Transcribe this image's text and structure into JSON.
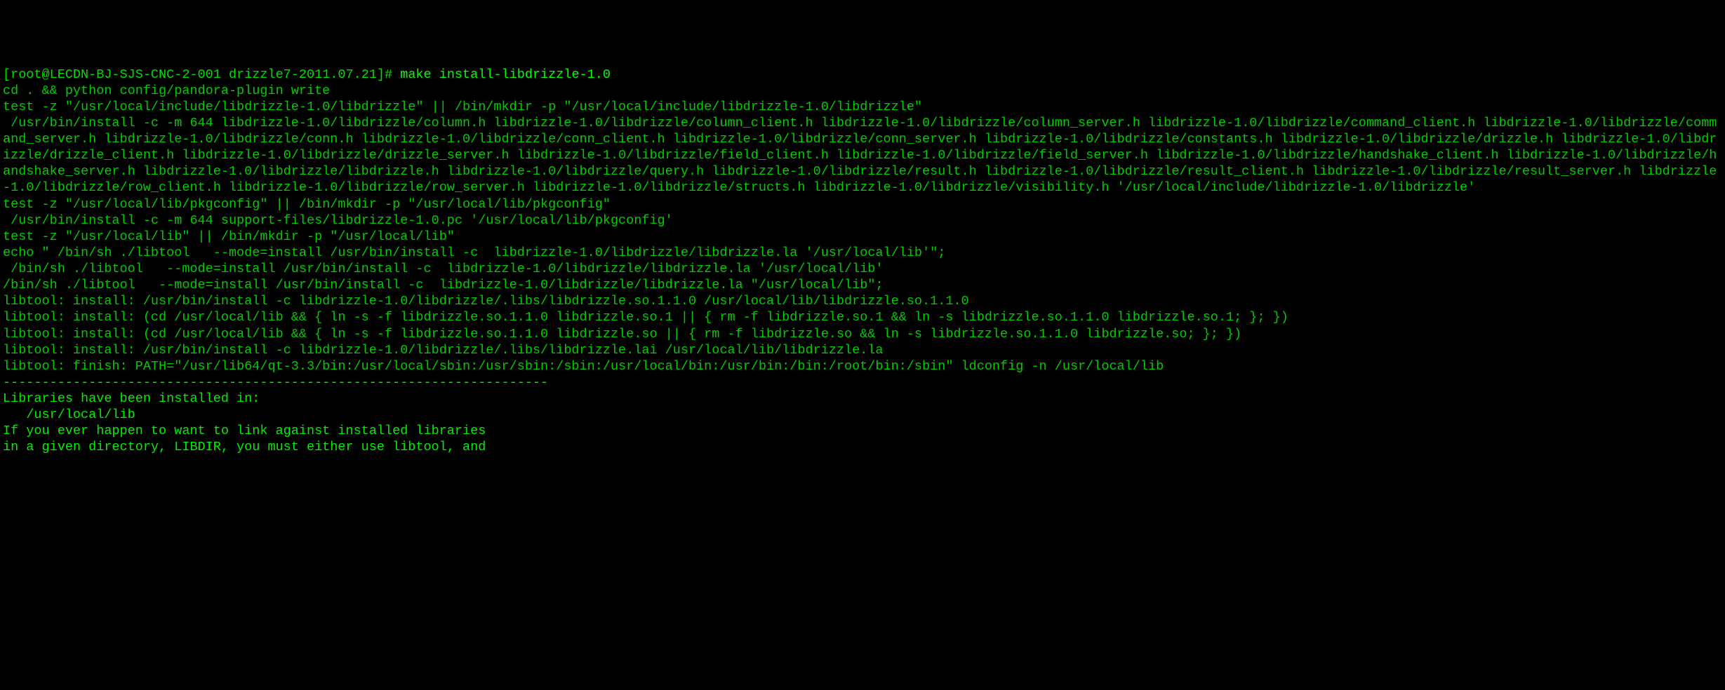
{
  "terminal": {
    "prompt": {
      "user_host": "[root@LECDN-BJ-SJS-CNC-2-001",
      "cwd": "drizzle7-2011.07.21]#",
      "command": "make install-libdrizzle-1.0"
    },
    "lines": [
      "cd . && python config/pandora-plugin write",
      "test -z \"/usr/local/include/libdrizzle-1.0/libdrizzle\" || /bin/mkdir -p \"/usr/local/include/libdrizzle-1.0/libdrizzle\"",
      " /usr/bin/install -c -m 644 libdrizzle-1.0/libdrizzle/column.h libdrizzle-1.0/libdrizzle/column_client.h libdrizzle-1.0/libdrizzle/column_server.h libdrizzle-1.0/libdrizzle/command_client.h libdrizzle-1.0/libdrizzle/command_server.h libdrizzle-1.0/libdrizzle/conn.h libdrizzle-1.0/libdrizzle/conn_client.h libdrizzle-1.0/libdrizzle/conn_server.h libdrizzle-1.0/libdrizzle/constants.h libdrizzle-1.0/libdrizzle/drizzle.h libdrizzle-1.0/libdrizzle/drizzle_client.h libdrizzle-1.0/libdrizzle/drizzle_server.h libdrizzle-1.0/libdrizzle/field_client.h libdrizzle-1.0/libdrizzle/field_server.h libdrizzle-1.0/libdrizzle/handshake_client.h libdrizzle-1.0/libdrizzle/handshake_server.h libdrizzle-1.0/libdrizzle/libdrizzle.h libdrizzle-1.0/libdrizzle/query.h libdrizzle-1.0/libdrizzle/result.h libdrizzle-1.0/libdrizzle/result_client.h libdrizzle-1.0/libdrizzle/result_server.h libdrizzle-1.0/libdrizzle/row_client.h libdrizzle-1.0/libdrizzle/row_server.h libdrizzle-1.0/libdrizzle/structs.h libdrizzle-1.0/libdrizzle/visibility.h '/usr/local/include/libdrizzle-1.0/libdrizzle'",
      "test -z \"/usr/local/lib/pkgconfig\" || /bin/mkdir -p \"/usr/local/lib/pkgconfig\"",
      " /usr/bin/install -c -m 644 support-files/libdrizzle-1.0.pc '/usr/local/lib/pkgconfig'",
      "test -z \"/usr/local/lib\" || /bin/mkdir -p \"/usr/local/lib\"",
      "echo \" /bin/sh ./libtool   --mode=install /usr/bin/install -c  libdrizzle-1.0/libdrizzle/libdrizzle.la '/usr/local/lib'\";",
      " /bin/sh ./libtool   --mode=install /usr/bin/install -c  libdrizzle-1.0/libdrizzle/libdrizzle.la '/usr/local/lib'",
      "/bin/sh ./libtool   --mode=install /usr/bin/install -c  libdrizzle-1.0/libdrizzle/libdrizzle.la \"/usr/local/lib\";",
      "libtool: install: /usr/bin/install -c libdrizzle-1.0/libdrizzle/.libs/libdrizzle.so.1.1.0 /usr/local/lib/libdrizzle.so.1.1.0",
      "libtool: install: (cd /usr/local/lib && { ln -s -f libdrizzle.so.1.1.0 libdrizzle.so.1 || { rm -f libdrizzle.so.1 && ln -s libdrizzle.so.1.1.0 libdrizzle.so.1; }; })",
      "libtool: install: (cd /usr/local/lib && { ln -s -f libdrizzle.so.1.1.0 libdrizzle.so || { rm -f libdrizzle.so && ln -s libdrizzle.so.1.1.0 libdrizzle.so; }; })",
      "libtool: install: /usr/bin/install -c libdrizzle-1.0/libdrizzle/.libs/libdrizzle.lai /usr/local/lib/libdrizzle.la",
      "libtool: finish: PATH=\"/usr/lib64/qt-3.3/bin:/usr/local/sbin:/usr/sbin:/sbin:/usr/local/bin:/usr/bin:/bin:/root/bin:/sbin\" ldconfig -n /usr/local/lib",
      "----------------------------------------------------------------------",
      "Libraries have been installed in:",
      "   /usr/local/lib",
      "",
      "If you ever happen to want to link against installed libraries",
      "in a given directory, LIBDIR, you must either use libtool, and"
    ]
  }
}
